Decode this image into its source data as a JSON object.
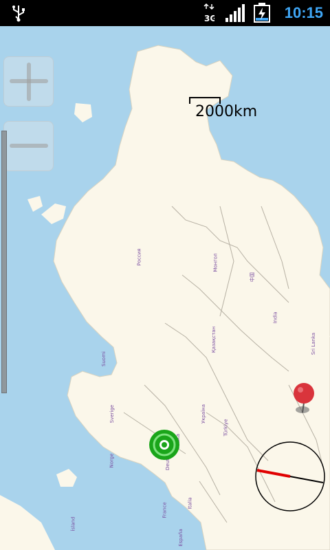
{
  "status_bar": {
    "time": "10:15",
    "network": "3G",
    "icons": [
      "usb-icon",
      "data-transfer-icon",
      "signal-icon",
      "battery-charging-icon"
    ]
  },
  "map": {
    "scale_label": "2000km",
    "controls": {
      "zoom_in": "+",
      "zoom_out": "−"
    },
    "labels": [
      "Россия",
      "Монгол",
      "中国",
      "India",
      "Україна",
      "Türkiye",
      "Sverige",
      "Norge",
      "Suomi",
      "France",
      "España",
      "Italia",
      "Deutschland",
      "Polska",
      "Ísland",
      "Қазақстан",
      "Sri Lanka"
    ],
    "markers": [
      "red-pin-marker",
      "green-location-marker"
    ],
    "compass": "compass-rose"
  },
  "colors": {
    "water": "#a9d3ec",
    "land": "#fbf7ea",
    "accent": "#3fa6f5"
  }
}
